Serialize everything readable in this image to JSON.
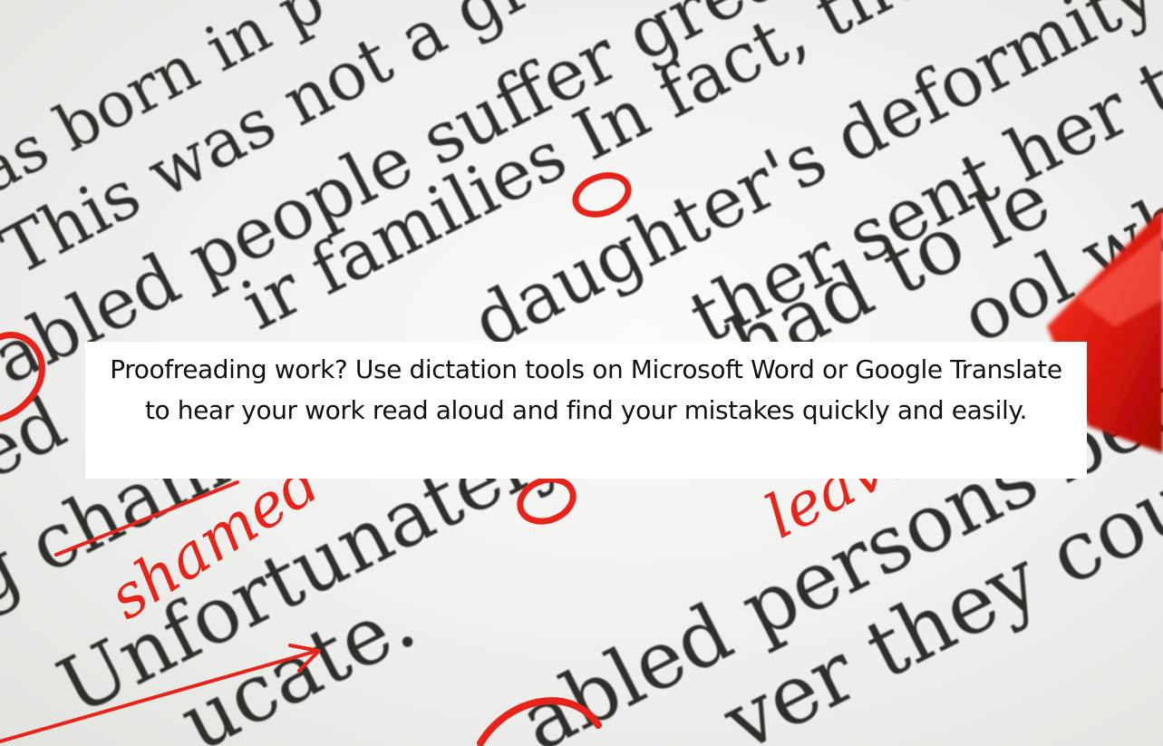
{
  "caption": {
    "text": "Proofreading work? Use dictation tools on Microsoft Word or Google Translate to hear your work read aloud and find your mistakes quickly and easily."
  },
  "photo": {
    "text_lines": [
      "as born in p",
      "This was not a grea",
      "abled people suffer great",
      "ir families In fact, the",
      "daughter's deformity",
      "ther sent her to",
      "ed",
      "ool wh",
      "g chame",
      "Unfortunately She had to le",
      "abled persons became",
      "ucate.",
      "ver they could"
    ],
    "handwritten_annotations": [
      "shamed",
      "leave"
    ],
    "ink_color": "#e8231a",
    "print_color": "#2e2e2c"
  }
}
